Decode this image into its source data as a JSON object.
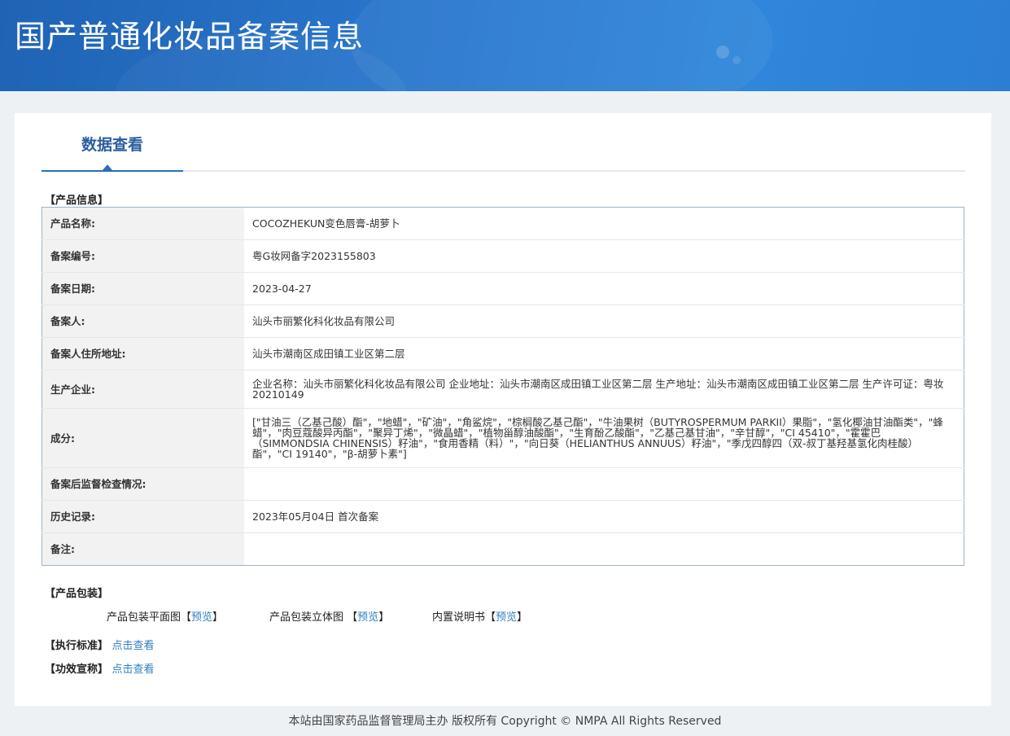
{
  "header": {
    "title": "国产普通化妆品备案信息"
  },
  "tab": {
    "label": "数据查看"
  },
  "sections": {
    "product_info": "【产品信息】",
    "packaging": "【产品包装】",
    "standard": "【执行标准】",
    "efficacy": "【功效宣称】"
  },
  "table": {
    "rows": [
      {
        "label": "产品名称:",
        "value": "COCOZHEKUN变色唇膏-胡萝卜"
      },
      {
        "label": "备案编号:",
        "value": "粤G妆网备字2023155803"
      },
      {
        "label": "备案日期:",
        "value": "2023-04-27"
      },
      {
        "label": "备案人:",
        "value": "汕头市丽繁化科化妆品有限公司"
      },
      {
        "label": "备案人住所地址:",
        "value": "汕头市潮南区成田镇工业区第二层"
      },
      {
        "label": "生产企业:",
        "value": "企业名称：汕头市丽繁化科化妆品有限公司 企业地址：汕头市潮南区成田镇工业区第二层 生产地址：汕头市潮南区成田镇工业区第二层 生产许可证：粤妆20210149"
      },
      {
        "label": "成分:",
        "value": "[\"甘油三（乙基己酸）酯\"，\"地蜡\"，\"矿油\"，\"角鲨烷\"，\"棕榈酸乙基己酯\"，\"牛油果树（BUTYROSPERMUM PARKII）果脂\"，\"氢化椰油甘油酯类\"，\"蜂蜡\"，\"肉豆蔻酸异丙酯\"，\"聚异丁烯\"，\"微晶蜡\"，\"植物甾醇油酸酯\"，\"生育酚乙酸酯\"，\"乙基己基甘油\"，\"辛甘醇\"，\"CI 45410\"，\"霍霍巴（SIMMONDSIA CHINENSIS）籽油\"，\"食用香精（料）\"，\"向日葵（HELIANTHUS ANNUUS）籽油\"，\"季戊四醇四（双-叔丁基羟基氢化肉桂酸）酯\"，\"CI 19140\"，\"β-胡萝卜素\"]"
      },
      {
        "label": "备案后监督检查情况:",
        "value": ""
      },
      {
        "label": "历史记录:",
        "value": "2023年05月04日 首次备案"
      },
      {
        "label": "备注:",
        "value": ""
      }
    ]
  },
  "packaging": {
    "flat": "产品包装平面图",
    "stereo": "产品包装立体图",
    "manual": "内置说明书",
    "preview": "预览",
    "bracket_open": "【",
    "bracket_close": "】"
  },
  "links": {
    "view": "点击查看"
  },
  "footer": {
    "text": "本站由国家药品监督管理局主办 版权所有 Copyright © NMPA All Rights Reserved"
  }
}
